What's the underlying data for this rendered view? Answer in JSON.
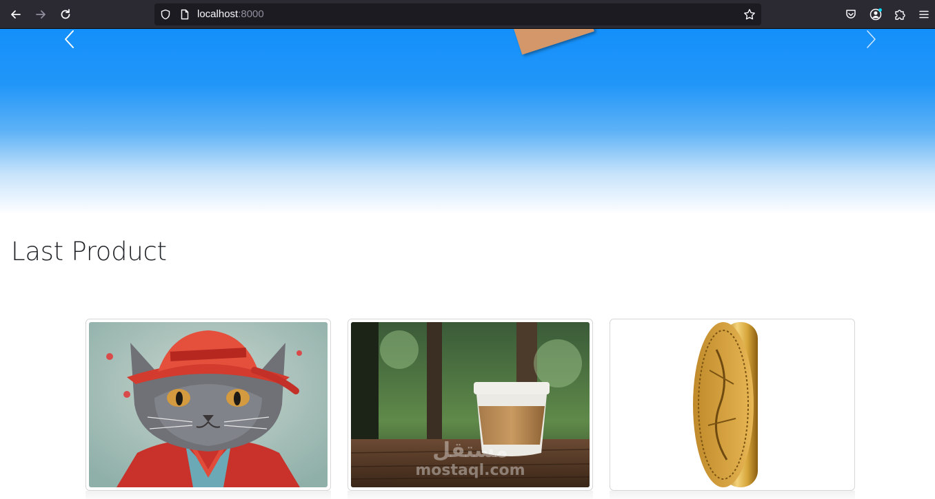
{
  "browser": {
    "url_host": "localhost",
    "url_port": ":8000"
  },
  "page": {
    "section_title": "Last Product"
  },
  "products": [
    {
      "image": "cat-in-red-hat"
    },
    {
      "image": "coffee-cup"
    },
    {
      "image": "gold-coin"
    }
  ],
  "watermark": {
    "arabic": "مستقل",
    "latin": "mostaql.com"
  },
  "colors": {
    "chrome_bg": "#2b2a33",
    "urlbar_bg": "#1c1b22",
    "hero_top": "#1490fb",
    "title_text": "#212529"
  }
}
